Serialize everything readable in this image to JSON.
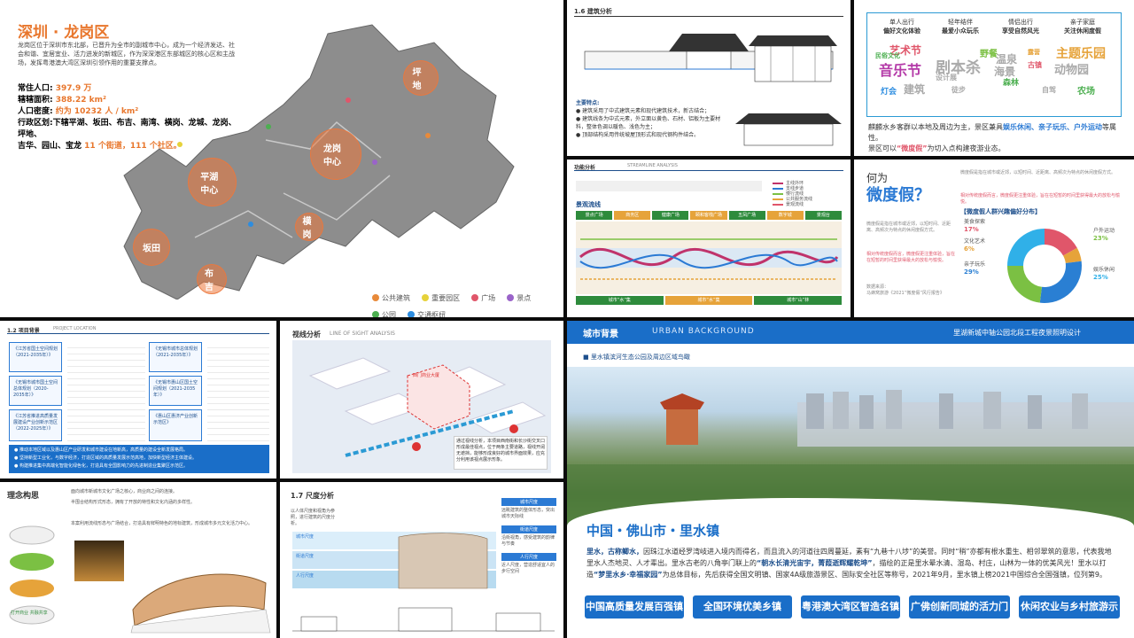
{
  "longgang": {
    "title": "深圳 · 龙岗区",
    "intro": "龙岗区位于深圳市东北部，已晋升为全市的副城市中心，成为一个经济发达、社会和谐、宜居宜业、活力迸发的新城区，作为深深港区东部城区的核心区和主战场，发挥粤港澳大湾区深圳引领作用的重要支撑点。",
    "stats": [
      {
        "label": "常住人口:",
        "value": "397.9 万"
      },
      {
        "label": "辖辖面积:",
        "value": "388.22 km²"
      },
      {
        "label": "人口密度:",
        "value": "约为 10232 人 / km²"
      }
    ],
    "districts_label": "行政区划:",
    "districts_text": "下辖平湖、坂田、布吉、南湾、横岗、龙城、龙岗、坪地、",
    "districts_text2": "吉华、园山、宝龙",
    "districts_suffix": "11 个街道，111 个社区。",
    "centers": [
      "坪地",
      "龙岗中心",
      "平湖中心",
      "坂田",
      "横岗",
      "布吉"
    ],
    "legend": [
      "公共建筑",
      "重要园区",
      "广场",
      "景点",
      "公园",
      "交通枢纽"
    ],
    "legend_colors": [
      "#e88a3a",
      "#e6d23a",
      "#e0566a",
      "#9a63c9",
      "#4caf50",
      "#2d8de0"
    ]
  },
  "arch": {
    "num": "1.6",
    "title": "建筑分析",
    "points_title": "主要特点:",
    "points": [
      "● 建筑采用了中式建筑元素和现代建筑技术，新古结合；",
      "● 建筑线条为中式元素，外立面以黄色、石材、铝板为主要材料，整体色调以暖色、浅色为主；",
      "● 顶部结构采用传统坡屋顶形式和现代钢构件结合。"
    ]
  },
  "leisure": {
    "heads": [
      "单人出行",
      "轻年结伴",
      "情侣出行",
      "亲子家庭"
    ],
    "subs": [
      "偏好文化体验",
      "最爱小众玩乐",
      "享受自然风光",
      "关注休闲度假"
    ],
    "words": [
      "艺术节",
      "音乐节",
      "剧本杀",
      "主题乐园",
      "动物园",
      "民俗文化",
      "灯会",
      "建筑",
      "野餐",
      "温泉",
      "海景",
      "森林",
      "露营",
      "农场",
      "古镇",
      "设计展",
      "徒步",
      "自驾"
    ],
    "caption1": "麒麟水乡客群以本地及周边为主，景区兼具",
    "caption_hl": "娱乐休闲、亲子玩乐、户外运动",
    "caption2": "等属性。",
    "caption3": "景区可以",
    "caption_q": "“微度假”",
    "caption4": "为切入点构建夜游业态。"
  },
  "stream": {
    "title": "功能分析",
    "sub": "STREAMLINE ANALYSIS",
    "section": "景观流线",
    "top_labels": [
      "景点广场",
      "商务区",
      "健康广场",
      "颐和客栈广场",
      "五凤广场",
      "数字城",
      "景观台"
    ],
    "bottom_labels": [
      "城市“水”集",
      "城市“水”集",
      "城市“山”林"
    ],
    "legend": [
      "主线外环",
      "支线步道",
      "慢行流线",
      "公共服务流线",
      "景观流线"
    ]
  },
  "why": {
    "title1": "何为",
    "title2": "微度假？",
    "chart_title": "【微度假人群兴趣偏好分布】",
    "intro": "微度假是指在城市或近郊，以短时间、近距离、高频次为特点的休闲度假方式。",
    "hl": "相对传统度假而言，微度假更注重体验，旨在在短暂的时间里获得最大的放松与愉悦。",
    "src_label": "数据来源：",
    "src": "马蜂窝旅游《2021“微度假”风行报告》"
  },
  "chart_data": {
    "type": "pie",
    "title": "【微度假人群兴趣偏好分布】",
    "categories": [
      "美食探索",
      "文化艺术",
      "亲子玩乐",
      "户外运动",
      "娱乐休闲"
    ],
    "values": [
      17,
      6,
      29,
      23,
      25
    ],
    "colors": [
      "#e0566a",
      "#e6a33a",
      "#2a7fd3",
      "#7bc043",
      "#30b0e8"
    ],
    "value_labels": [
      "17%",
      "6%",
      "29%",
      "23%",
      "25%"
    ]
  },
  "bg": {
    "num": "1.2",
    "title": "项目背景",
    "sub": "PROJECT LOCATION",
    "boxes": [
      "《江苏省国土空间规划（2021-2035年）》",
      "《无锡市城市总体规划（2021-2035年）》",
      "《无锡市城市国土空间总体规划（2020-2035年）》",
      "《无锡市惠山区国土空间规划（2021-2035年）》",
      "《江苏省推进高质量发展建设产业创新示范区（2022-2025年）》",
      "《惠山区惠济产业创新示范区》"
    ],
    "bullets": [
      "● 推动本地区域以及惠山区产业研发和城市建设在地新高，高质量的建设全新发展格局。",
      "● 坚持新型工业化，与数字经济，打造区域的高质量发展示范高地，加快新型经济主体建设。",
      "● 构建推进集中高端化智能化绿色化，打造具有全国影响力的先进制造业集聚区示范区。"
    ]
  },
  "sight": {
    "title": "视线分析",
    "sub": "LINE OF SIGHT ANALYSIS",
    "label_building": "西门商业大厦",
    "note": "通过视线分析，本项目西南街和长沙街交叉口形成最佳视点，位于两条主要道路，视线开阔无遮挡，能够形成良好的城市界面效果，应充分利用该视点展示形象。"
  },
  "concept": {
    "title": "理念构思",
    "intro": "面向城市新城市文化广场之核心，商业商之间的连接。",
    "p1": "半围合结构形式形态，拥有了开放的特性和文化内涵的多样性。",
    "p2": "本案利用流线形态与广场结合，打造具有鲜明特色的地标建筑，形成城市多元文化活力中心。",
    "side": "打开商业 共融共享"
  },
  "scale": {
    "num": "1.7",
    "title": "尺度分析",
    "intro": "以人体尺度和视角为参照，进行建筑的尺度分析。",
    "views": [
      "城市尺度",
      "街道尺度",
      "人行尺度"
    ],
    "labels": [
      "城市尺度",
      "街道尺度",
      "人行尺度"
    ],
    "notes": [
      "远眺建筑的整体形态，突出城市天际线",
      "沿街视角，感受建筑的韵律与节奏",
      "近人尺度，营造舒适宜人的步行空间"
    ]
  },
  "lishui": {
    "tag": "城市背景",
    "en": "URBAN   BACKGROUND",
    "right": "里湖新城中轴公园北段工程夜景照明设计",
    "caption": "■ 里水镇滨河生态公园及周边区域鸟瞰",
    "title": "中国・佛山市・里水镇",
    "body_a": "里水，古称鲫水，",
    "body_b": "因珠江水道经罗湾岐进入境内而得名，而且流入的河道往四周蔓延，素有“九巷十八埗”的美誉。同时“稍”亦都有根水重生、相邻翠筑的意思，代表我地里水人杰地灵、人才辈出。里水古老的八角亭门联上的",
    "body_c": "“朝水长清光宙宇，菁葭逝辉耀乾坤”",
    "body_d": "，描绘的正是里水晕水清、湿岛、村庄，山林为一体的优美风光！里水以打造",
    "body_e": "“梦里水乡·幸福家园”",
    "body_f": "为总体目标，先后获得全国文明镇、国家4A级旅游景区、国际安全社区等称号，2021年9月，里水镇上榜2021中国综合全国强镇，位列第9。",
    "buttons": [
      "中国高质量发展百强镇",
      "全国环境优美乡镇",
      "粤港澳大湾区智造名镇",
      "广佛创新同城的活力门户",
      "休闲农业与乡村旅游示范镇"
    ]
  }
}
